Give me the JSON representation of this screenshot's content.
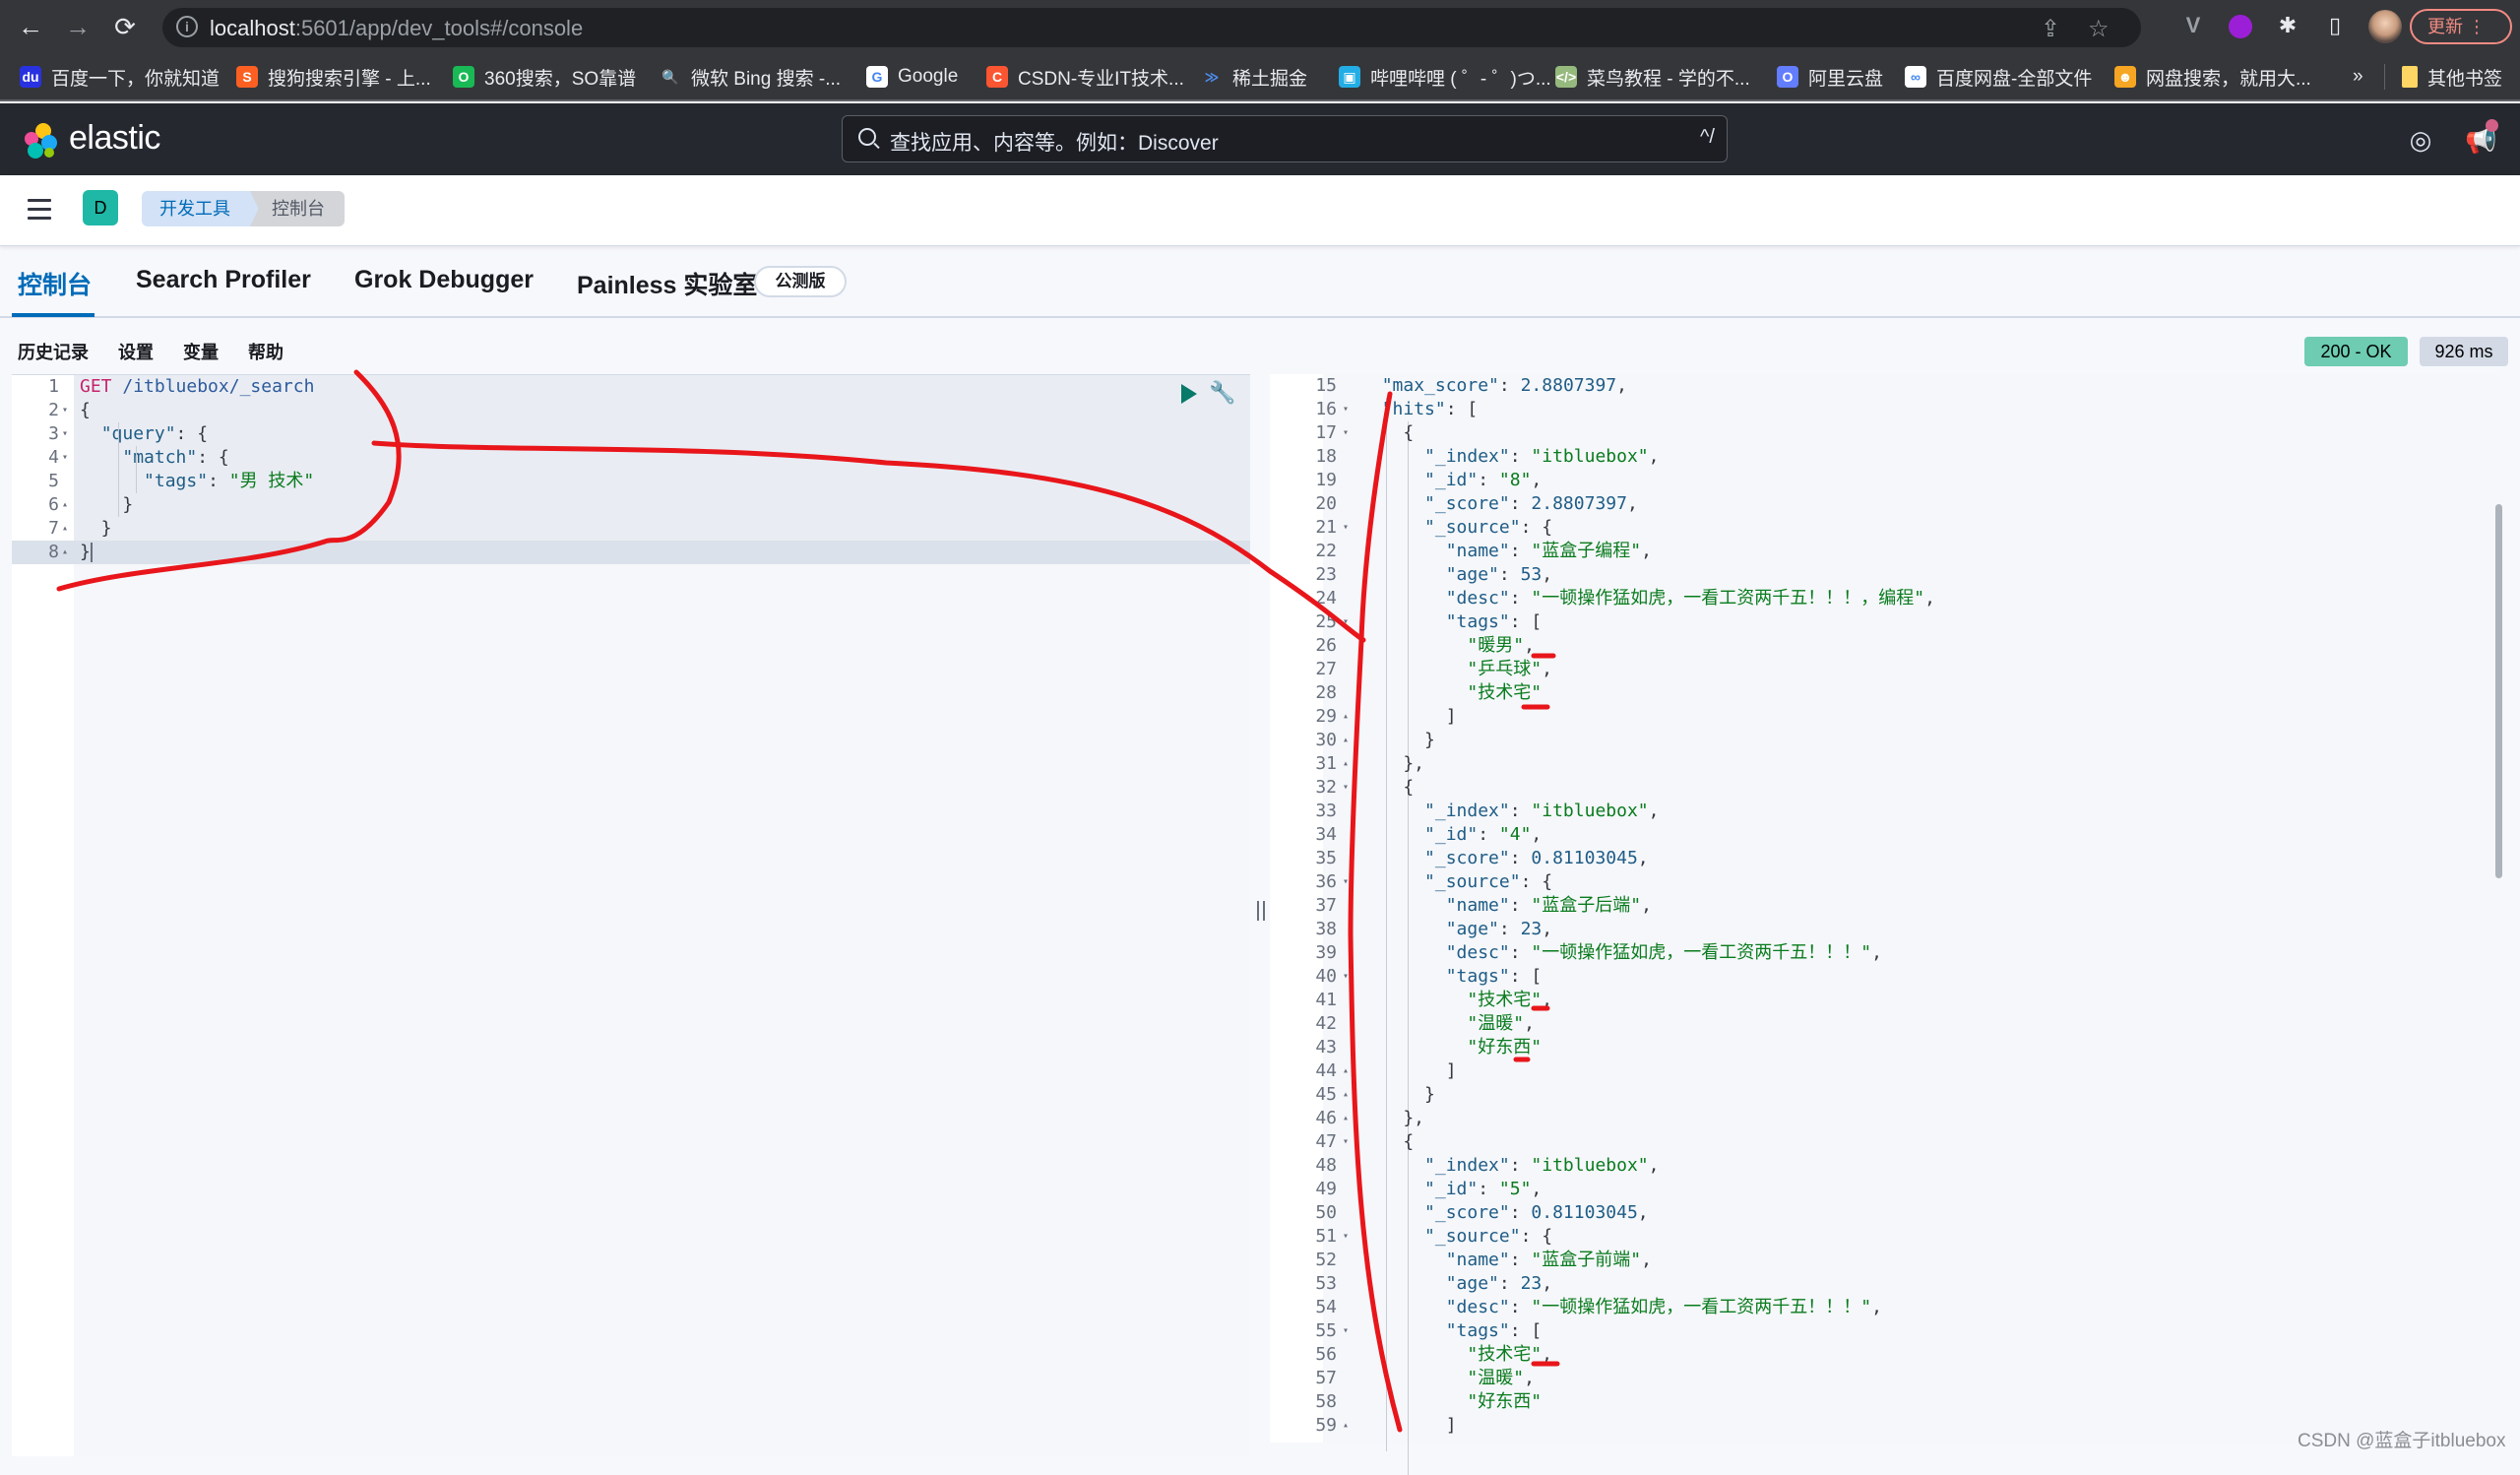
{
  "browser": {
    "url_host": "localhost",
    "url_rest": ":5601/app/dev_tools#/console",
    "update_label": "更新",
    "nav": {
      "back": "←",
      "forward": "→",
      "reload": "⟳"
    },
    "bookmarks": [
      {
        "label": "百度一下，你就知道",
        "icon": "baidu-icon",
        "color": "#2932e1",
        "glyph": "du"
      },
      {
        "label": "搜狗搜索引擎 - 上...",
        "icon": "sogou-icon",
        "color": "#fb6022",
        "glyph": "S"
      },
      {
        "label": "360搜索，SO靠谱",
        "icon": "360-icon",
        "color": "#19b955",
        "glyph": "O"
      },
      {
        "label": "微软 Bing 搜索 -...",
        "icon": "bing-search-icon",
        "color": "#35363a",
        "glyph": "🔍"
      },
      {
        "label": "Google",
        "icon": "google-icon",
        "color": "#ffffff",
        "glyph": "G"
      },
      {
        "label": "CSDN-专业IT技术...",
        "icon": "csdn-icon",
        "color": "#fc5531",
        "glyph": "C"
      },
      {
        "label": "稀土掘金",
        "icon": "juejin-icon",
        "color": "#35363a",
        "glyph": "≫"
      },
      {
        "label": "哔哩哔哩 ( ゜- ゜)つ...",
        "icon": "bilibili-icon",
        "color": "#23ade5",
        "glyph": "▣"
      },
      {
        "label": "菜鸟教程 - 学的不...",
        "icon": "runoob-icon",
        "color": "#96b97d",
        "glyph": "</>"
      },
      {
        "label": "阿里云盘",
        "icon": "aliyun-drive-icon",
        "color": "#637dff",
        "glyph": "O"
      },
      {
        "label": "百度网盘-全部文件",
        "icon": "baidu-netdisk-icon",
        "color": "#ffffff",
        "glyph": "∞"
      },
      {
        "label": "网盘搜索，就用大...",
        "icon": "pan-search-icon",
        "color": "#f6a623",
        "glyph": "☻"
      }
    ],
    "more_bookmarks": "»",
    "other_bookmarks": "其他书签"
  },
  "kibana": {
    "logo_text": "elastic",
    "search_placeholder": "查找应用、内容等。例如：Discover",
    "search_shortcut": "^/",
    "space_initial": "D",
    "breadcrumbs": [
      "开发工具",
      "控制台"
    ],
    "tabs": [
      {
        "label": "控制台",
        "active": true
      },
      {
        "label": "Search Profiler",
        "active": false
      },
      {
        "label": "Grok Debugger",
        "active": false
      },
      {
        "label": "Painless 实验室",
        "active": false
      }
    ],
    "beta_badge": "公测版",
    "toolbar": [
      "历史记录",
      "设置",
      "变量",
      "帮助"
    ],
    "status": "200 - OK",
    "duration": "926 ms",
    "accent": "#006bb8",
    "status_color": "#6dccb1"
  },
  "request": {
    "lines": [
      {
        "n": "1",
        "fold": "",
        "text": "GET /itbluebox/_search"
      },
      {
        "n": "2",
        "fold": "▾",
        "text": "{"
      },
      {
        "n": "3",
        "fold": "▾",
        "text": "  \"query\": {"
      },
      {
        "n": "4",
        "fold": "▾",
        "text": "    \"match\": {"
      },
      {
        "n": "5",
        "fold": "",
        "text": "      \"tags\": \"男 技术\""
      },
      {
        "n": "6",
        "fold": "▴",
        "text": "    }"
      },
      {
        "n": "7",
        "fold": "▴",
        "text": "  }"
      },
      {
        "n": "8",
        "fold": "▴",
        "text": "}"
      }
    ]
  },
  "response": {
    "lines": [
      {
        "n": "15",
        "fold": "",
        "text": "  \"max_score\": 2.8807397,"
      },
      {
        "n": "16",
        "fold": "▾",
        "text": "  \"hits\": ["
      },
      {
        "n": "17",
        "fold": "▾",
        "text": "    {"
      },
      {
        "n": "18",
        "fold": "",
        "text": "      \"_index\": \"itbluebox\","
      },
      {
        "n": "19",
        "fold": "",
        "text": "      \"_id\": \"8\","
      },
      {
        "n": "20",
        "fold": "",
        "text": "      \"_score\": 2.8807397,"
      },
      {
        "n": "21",
        "fold": "▾",
        "text": "      \"_source\": {"
      },
      {
        "n": "22",
        "fold": "",
        "text": "        \"name\": \"蓝盒子编程\","
      },
      {
        "n": "23",
        "fold": "",
        "text": "        \"age\": 53,"
      },
      {
        "n": "24",
        "fold": "",
        "text": "        \"desc\": \"一顿操作猛如虎，一看工资两千五！！！，编程\","
      },
      {
        "n": "25",
        "fold": "▾",
        "text": "        \"tags\": ["
      },
      {
        "n": "26",
        "fold": "",
        "text": "          \"暖男\","
      },
      {
        "n": "27",
        "fold": "",
        "text": "          \"乒乓球\","
      },
      {
        "n": "28",
        "fold": "",
        "text": "          \"技术宅\""
      },
      {
        "n": "29",
        "fold": "▴",
        "text": "        ]"
      },
      {
        "n": "30",
        "fold": "▴",
        "text": "      }"
      },
      {
        "n": "31",
        "fold": "▴",
        "text": "    },"
      },
      {
        "n": "32",
        "fold": "▾",
        "text": "    {"
      },
      {
        "n": "33",
        "fold": "",
        "text": "      \"_index\": \"itbluebox\","
      },
      {
        "n": "34",
        "fold": "",
        "text": "      \"_id\": \"4\","
      },
      {
        "n": "35",
        "fold": "",
        "text": "      \"_score\": 0.81103045,"
      },
      {
        "n": "36",
        "fold": "▾",
        "text": "      \"_source\": {"
      },
      {
        "n": "37",
        "fold": "",
        "text": "        \"name\": \"蓝盒子后端\","
      },
      {
        "n": "38",
        "fold": "",
        "text": "        \"age\": 23,"
      },
      {
        "n": "39",
        "fold": "",
        "text": "        \"desc\": \"一顿操作猛如虎，一看工资两千五！！！\","
      },
      {
        "n": "40",
        "fold": "▾",
        "text": "        \"tags\": ["
      },
      {
        "n": "41",
        "fold": "",
        "text": "          \"技术宅\","
      },
      {
        "n": "42",
        "fold": "",
        "text": "          \"温暖\","
      },
      {
        "n": "43",
        "fold": "",
        "text": "          \"好东西\""
      },
      {
        "n": "44",
        "fold": "▴",
        "text": "        ]"
      },
      {
        "n": "45",
        "fold": "▴",
        "text": "      }"
      },
      {
        "n": "46",
        "fold": "▴",
        "text": "    },"
      },
      {
        "n": "47",
        "fold": "▾",
        "text": "    {"
      },
      {
        "n": "48",
        "fold": "",
        "text": "      \"_index\": \"itbluebox\","
      },
      {
        "n": "49",
        "fold": "",
        "text": "      \"_id\": \"5\","
      },
      {
        "n": "50",
        "fold": "",
        "text": "      \"_score\": 0.81103045,"
      },
      {
        "n": "51",
        "fold": "▾",
        "text": "      \"_source\": {"
      },
      {
        "n": "52",
        "fold": "",
        "text": "        \"name\": \"蓝盒子前端\","
      },
      {
        "n": "53",
        "fold": "",
        "text": "        \"age\": 23,"
      },
      {
        "n": "54",
        "fold": "",
        "text": "        \"desc\": \"一顿操作猛如虎，一看工资两千五！！！\","
      },
      {
        "n": "55",
        "fold": "▾",
        "text": "        \"tags\": ["
      },
      {
        "n": "56",
        "fold": "",
        "text": "          \"技术宅\","
      },
      {
        "n": "57",
        "fold": "",
        "text": "          \"温暖\","
      },
      {
        "n": "58",
        "fold": "",
        "text": "          \"好东西\""
      },
      {
        "n": "59",
        "fold": "▴",
        "text": "        ]"
      }
    ]
  },
  "watermark": "CSDN @蓝盒子itbluebox",
  "annotation_color": "#e8161b"
}
